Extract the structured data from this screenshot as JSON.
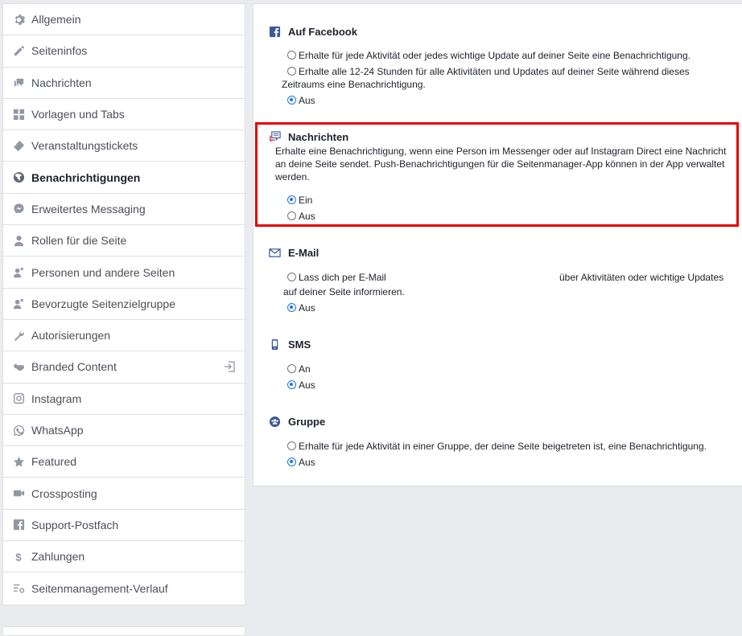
{
  "sidebar": {
    "items": [
      {
        "label": "Allgemein",
        "icon": "gear-icon"
      },
      {
        "label": "Seiteninfos",
        "icon": "pencil-icon"
      },
      {
        "label": "Nachrichten",
        "icon": "chat-icon"
      },
      {
        "label": "Vorlagen und Tabs",
        "icon": "grid-icon"
      },
      {
        "label": "Veranstaltungstickets",
        "icon": "ticket-icon"
      },
      {
        "label": "Benachrichtigungen",
        "icon": "globe-icon"
      },
      {
        "label": "Erweitertes Messaging",
        "icon": "messenger-icon"
      },
      {
        "label": "Rollen für die Seite",
        "icon": "person-icon"
      },
      {
        "label": "Personen und andere Seiten",
        "icon": "person-star-icon"
      },
      {
        "label": "Bevorzugte Seitenzielgruppe",
        "icon": "person-star-icon"
      },
      {
        "label": "Autorisierungen",
        "icon": "wrench-icon"
      },
      {
        "label": "Branded Content",
        "icon": "handshake-icon"
      },
      {
        "label": "Instagram",
        "icon": "instagram-icon"
      },
      {
        "label": "WhatsApp",
        "icon": "whatsapp-icon"
      },
      {
        "label": "Featured",
        "icon": "star-icon"
      },
      {
        "label": "Crossposting",
        "icon": "video-icon"
      },
      {
        "label": "Support-Postfach",
        "icon": "facebook-icon"
      },
      {
        "label": "Zahlungen",
        "icon": "dollar-icon"
      },
      {
        "label": "Seitenmanagement-Verlauf",
        "icon": "list-gear-icon"
      }
    ],
    "active_index": 5
  },
  "sections": {
    "facebook": {
      "title": "Auf Facebook",
      "options": [
        "Erhalte für jede Aktivität oder jedes wichtige Update auf deiner Seite eine Benachrichtigung.",
        "Erhalte alle 12-24 Stunden für alle Aktivitäten und Updates auf deiner Seite während dieses",
        "Zeitraums eine Benachrichtigung.",
        "Aus"
      ]
    },
    "messages": {
      "title": "Nachrichten",
      "desc1": "Erhalte eine Benachrichtigung, wenn eine Person im Messenger oder auf Instagram Direct eine Nachricht",
      "desc2": "an deine Seite sendet. Push-Benachrichtigungen für die Seitenmanager-App können in der App verwaltet",
      "desc3": "werden.",
      "on": "Ein",
      "off": "Aus"
    },
    "email": {
      "title": "E-Mail",
      "option_a": "Lass dich per E-Mail",
      "option_b": "über Aktivitäten oder wichtige Updates",
      "option_c": "auf deiner Seite informieren.",
      "off": "Aus"
    },
    "sms": {
      "title": "SMS",
      "on": "An",
      "off": "Aus"
    },
    "group": {
      "title": "Gruppe",
      "option": "Erhalte für jede Aktivität in einer Gruppe, der deine Seite beigetreten ist, eine Benachrichtigung.",
      "off": "Aus"
    }
  },
  "colors": {
    "accent": "#1a73e8",
    "highlight": "#e60000",
    "facebook_blue": "#3b5998"
  }
}
